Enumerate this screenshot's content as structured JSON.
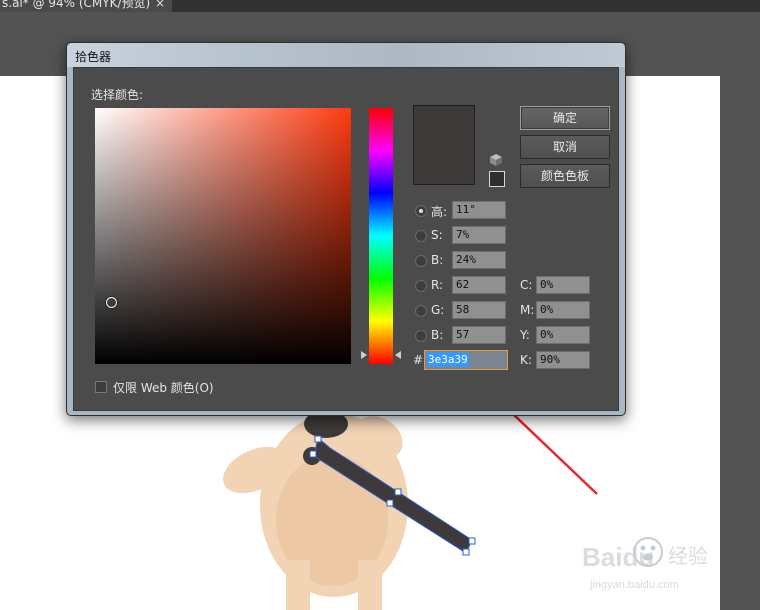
{
  "document": {
    "tab_title": "s.ai* @ 94% (CMYK/预览)",
    "close_glyph": "×"
  },
  "dialog": {
    "title": "拾色器",
    "select_color_label": "选择颜色:",
    "current_color": "#3e3a39",
    "buttons": {
      "ok": "确定",
      "cancel": "取消",
      "swatches": "颜色色板"
    },
    "hsb": [
      {
        "label": "高:",
        "value": "11°",
        "checked": true
      },
      {
        "label": "S:",
        "value": "7%",
        "checked": false
      },
      {
        "label": "B:",
        "value": "24%",
        "checked": false
      }
    ],
    "rgb": [
      {
        "label": "R:",
        "value": "62"
      },
      {
        "label": "G:",
        "value": "58"
      },
      {
        "label": "B:",
        "value": "57"
      }
    ],
    "cmyk": [
      {
        "label": "C:",
        "value": "0%"
      },
      {
        "label": "M:",
        "value": "0%"
      },
      {
        "label": "Y:",
        "value": "0%"
      },
      {
        "label": "K:",
        "value": "90%"
      }
    ],
    "hex_label": "#",
    "hex_value": "3e3a39",
    "web_only_label": "仅限 Web 颜色(O)",
    "web_only_checked": false
  },
  "watermark": {
    "brand": "Baidu",
    "cn": "经验",
    "url": "jingyan.baidu.com"
  },
  "colors": {
    "annotation_arrow": "#e8282a",
    "selection_path": "#2a5bd7",
    "artwork_skin": "#f2d3b3",
    "artwork_dark": "#3e3a39"
  }
}
